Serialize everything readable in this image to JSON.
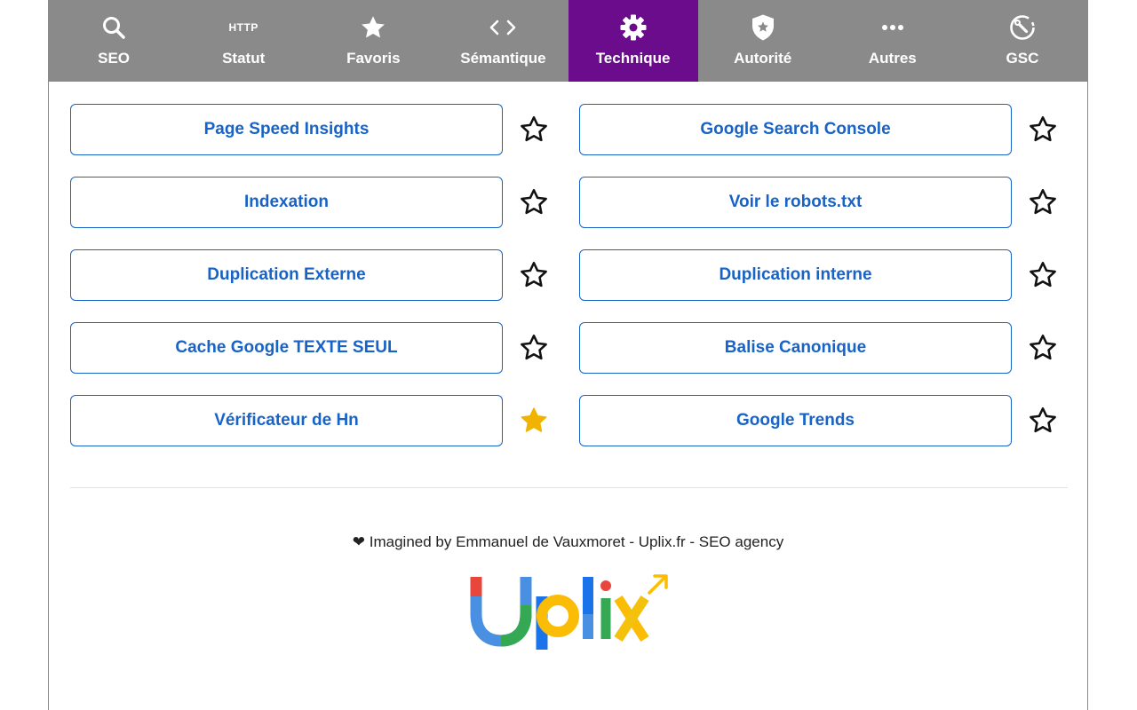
{
  "tabs": [
    {
      "label": "SEO",
      "icon": "search-icon",
      "active": false
    },
    {
      "label": "Statut",
      "icon": "http-icon",
      "icon_text": "HTTP",
      "active": false
    },
    {
      "label": "Favoris",
      "icon": "star-icon",
      "active": false
    },
    {
      "label": "Sémantique",
      "icon": "code-icon",
      "active": false
    },
    {
      "label": "Technique",
      "icon": "gear-icon",
      "active": true
    },
    {
      "label": "Autorité",
      "icon": "shield-icon",
      "active": false
    },
    {
      "label": "Autres",
      "icon": "more-dots-icon",
      "active": false
    },
    {
      "label": "GSC",
      "icon": "wrench-gauge-icon",
      "active": false
    }
  ],
  "tools": {
    "left": [
      {
        "label": "Page Speed Insights",
        "favorite": false
      },
      {
        "label": "Indexation",
        "favorite": false
      },
      {
        "label": "Duplication Externe",
        "favorite": false
      },
      {
        "label": "Cache Google TEXTE SEUL",
        "favorite": false
      },
      {
        "label": "Vérificateur de Hn",
        "favorite": true
      }
    ],
    "right": [
      {
        "label": "Google Search Console",
        "favorite": false
      },
      {
        "label": "Voir le robots.txt",
        "favorite": false
      },
      {
        "label": "Duplication interne",
        "favorite": false
      },
      {
        "label": "Balise Canonique",
        "favorite": false
      },
      {
        "label": "Google Trends",
        "favorite": false
      }
    ]
  },
  "footer": {
    "credit": "❤ Imagined by Emmanuel de Vauxmoret - Uplix.fr - SEO agency",
    "logo_text": "Uplix"
  },
  "colors": {
    "tabbar_bg": "#8a8a8a",
    "tab_active_bg": "#6a0c8c",
    "button_text": "#1863c7",
    "favorite_star": "#f0b400"
  }
}
